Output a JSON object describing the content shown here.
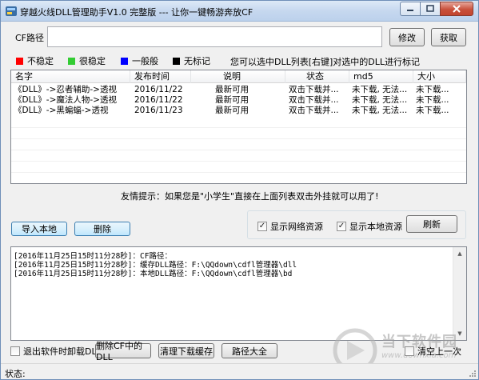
{
  "window": {
    "title": "穿越火线DLL管理助手V1.0 完整版 --- 让你一键畅游奔放CF"
  },
  "cf_path": {
    "label": "CF路径",
    "value": "",
    "modify_label": "修改",
    "fetch_label": "获取"
  },
  "legend": {
    "items": [
      {
        "label": "不稳定",
        "color": "#ff0000"
      },
      {
        "label": "很稳定",
        "color": "#33cc33"
      },
      {
        "label": "一般般",
        "color": "#0000ff"
      },
      {
        "label": "无标记",
        "color": "#000000"
      }
    ],
    "tip": "您可以选中DLL列表[右键]对选中的DLL进行标记"
  },
  "list": {
    "columns": [
      "名字",
      "发布时间",
      "说明",
      "状态",
      "md5",
      "大小"
    ],
    "rows": [
      [
        "《DLL》->忍者辅助->透视",
        "2016/11/22",
        "最新可用",
        "双击下载并...",
        "未下载, 无法...",
        "未下载..."
      ],
      [
        "《DLL》->魔法人物->透视",
        "2016/11/22",
        "最新可用",
        "双击下载并...",
        "未下载, 无法...",
        "未下载..."
      ],
      [
        "《DLL》->黑蝙蝠->透视",
        "2016/11/23",
        "最新可用",
        "双击下载并...",
        "未下载, 无法...",
        "未下载..."
      ]
    ]
  },
  "friendly_tip": "友情提示：如果您是\"小学生\"直接在上面列表双击外挂就可以用了!",
  "actions": {
    "import_label": "导入本地",
    "delete_label": "删除",
    "show_network_label": "显示网络资源",
    "show_network_checked": true,
    "show_local_label": "显示本地资源",
    "show_local_checked": true,
    "refresh_label": "刷新"
  },
  "log": {
    "lines": [
      "[2016年11月25日15时11分28秒]：CF路径：",
      "[2016年11月25日15时11分28秒]：缓存DLL路径：F:\\QQdown\\cdfl管理器\\dll",
      "[2016年11月25日15时11分28秒]：本地DLL路径：F:\\QQdown\\cdfl管理器\\bd"
    ]
  },
  "bottom": {
    "unload_on_exit_label": "退出软件时卸载DLL",
    "unload_on_exit_checked": false,
    "delete_cf_dll_label": "删除CF中的DLL",
    "clear_cache_label": "清理下载缓存",
    "path_all_label": "路径大全",
    "clear_prev_label": "清空上一次",
    "clear_prev_checked": false
  },
  "status": {
    "label": "状态:"
  },
  "watermark": {
    "brand": "当下软件园",
    "url": "www.downxia.com"
  }
}
